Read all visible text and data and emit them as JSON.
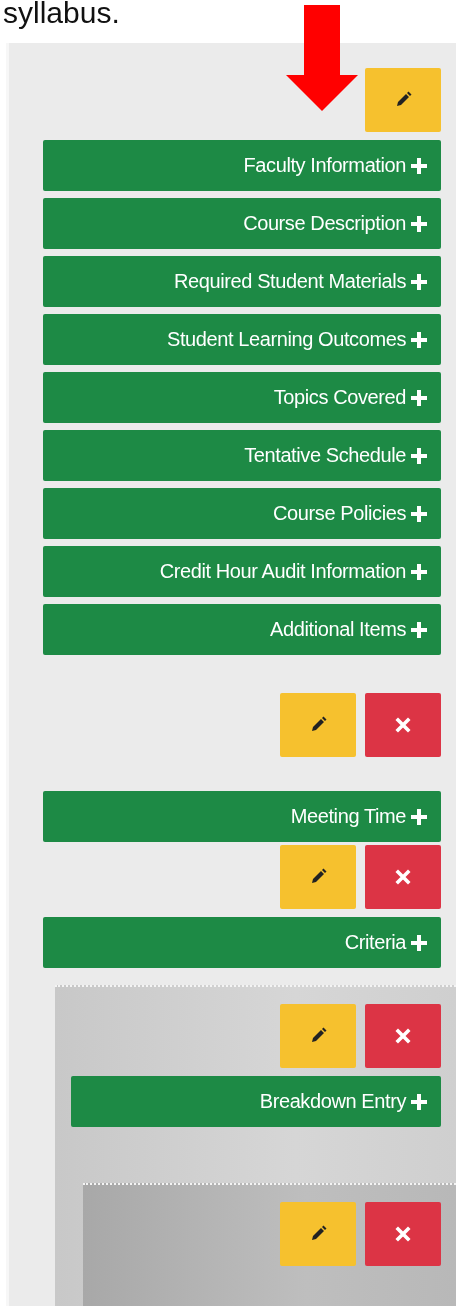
{
  "caption": "syllabus.",
  "blocks": [
    {
      "buttons": [
        {
          "kind": "edit"
        }
      ],
      "items": [
        "Faculty Information",
        "Course Description",
        "Required Student Materials",
        "Student Learning Outcomes",
        "Topics Covered",
        "Tentative Schedule",
        "Course Policies",
        "Credit Hour Audit Information",
        "Additional Items"
      ]
    },
    {
      "buttons": [
        {
          "kind": "edit"
        },
        {
          "kind": "delete"
        }
      ],
      "items": [
        "Meeting Time"
      ]
    },
    {
      "buttons": [
        {
          "kind": "edit"
        },
        {
          "kind": "delete"
        }
      ],
      "items": [
        "Criteria"
      ],
      "children": [
        {
          "buttons": [
            {
              "kind": "edit"
            },
            {
              "kind": "delete"
            }
          ],
          "items": [
            "Breakdown Entry"
          ],
          "children": [
            {
              "buttons": [
                {
                  "kind": "edit"
                },
                {
                  "kind": "delete"
                }
              ]
            }
          ]
        }
      ]
    }
  ]
}
